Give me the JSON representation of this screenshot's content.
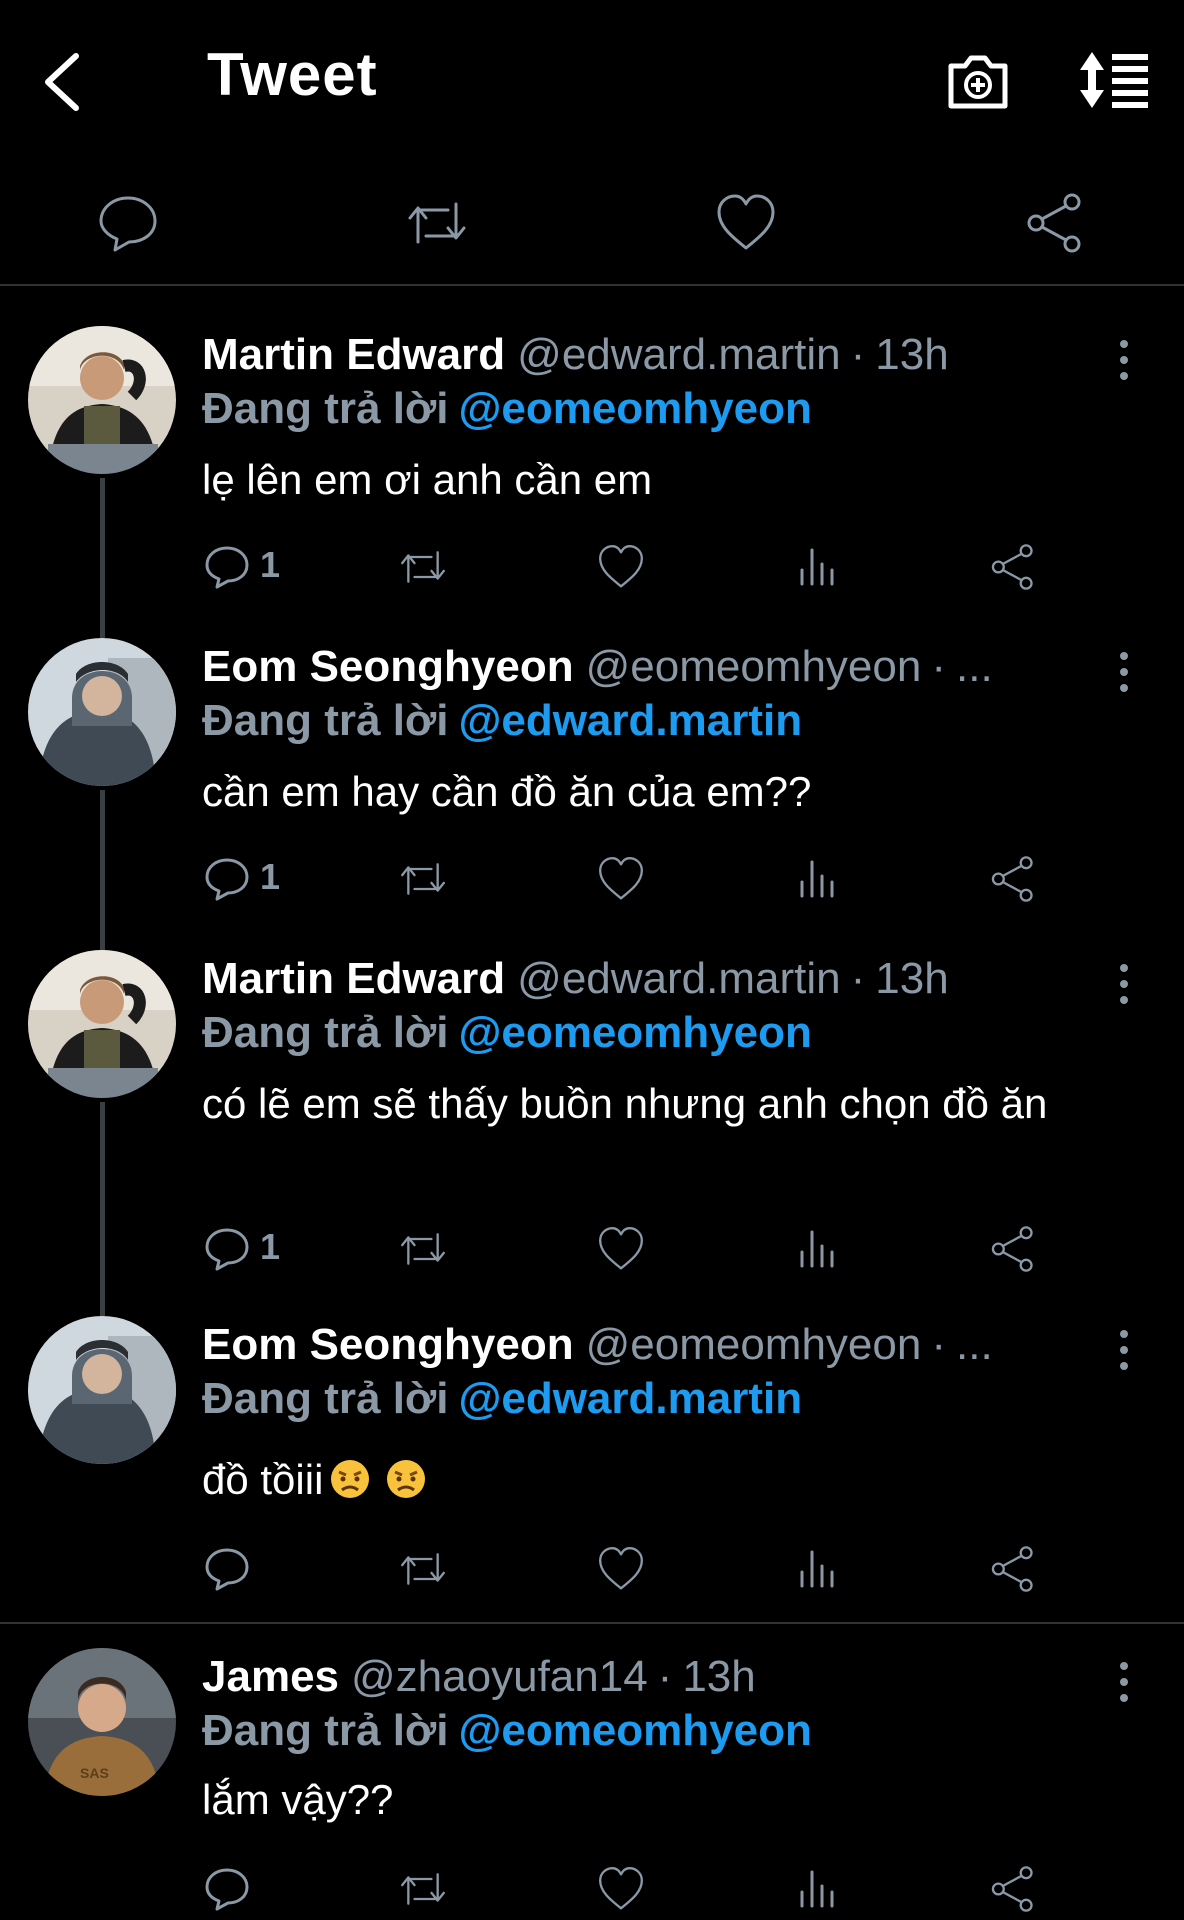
{
  "header": {
    "title": "Tweet",
    "back_icon": "chevron-left-icon",
    "camera_icon": "camera-plus-icon",
    "sort_icon": "sort-list-icon"
  },
  "action_bar": [
    "reply-icon",
    "retweet-icon",
    "like-icon",
    "share-icon"
  ],
  "colors": {
    "accent": "#1d9bf0",
    "muted": "#8b98a5",
    "background": "#000000"
  },
  "tweets": [
    {
      "name": "Martin Edward",
      "handle": "@edward.martin",
      "dot": "·",
      "time": "13h",
      "reply_to_label": "Đang trả lời",
      "reply_to_handle": "@eomeomhyeon",
      "text": "lẹ lên em ơi anh cần em",
      "reply_count": "1"
    },
    {
      "name": "Eom Seonghyeon",
      "handle": "@eomeomhyeon",
      "dot": "·",
      "time": "...",
      "reply_to_label": "Đang trả lời",
      "reply_to_handle": "@edward.martin",
      "text": "cần em hay cần đồ ăn của em??",
      "reply_count": "1"
    },
    {
      "name": "Martin Edward",
      "handle": "@edward.martin",
      "dot": "·",
      "time": "13h",
      "reply_to_label": "Đang trả lời",
      "reply_to_handle": "@eomeomhyeon",
      "text": "có lẽ em sẽ thấy buồn nhưng anh chọn đồ ăn",
      "reply_count": "1"
    },
    {
      "name": "Eom Seonghyeon",
      "handle": "@eomeomhyeon",
      "dot": "·",
      "time": "...",
      "reply_to_label": "Đang trả lời",
      "reply_to_handle": "@edward.martin",
      "text": "đồ tồiii",
      "emojis": [
        "angry-face-emoji",
        "angry-face-emoji"
      ],
      "reply_count": ""
    },
    {
      "name": "James",
      "handle": "@zhaoyufan14",
      "dot": "·",
      "time": "13h",
      "reply_to_label": "Đang trả lời",
      "reply_to_handle": "@eomeomhyeon",
      "text": "lắm vậy??",
      "reply_count": ""
    }
  ]
}
